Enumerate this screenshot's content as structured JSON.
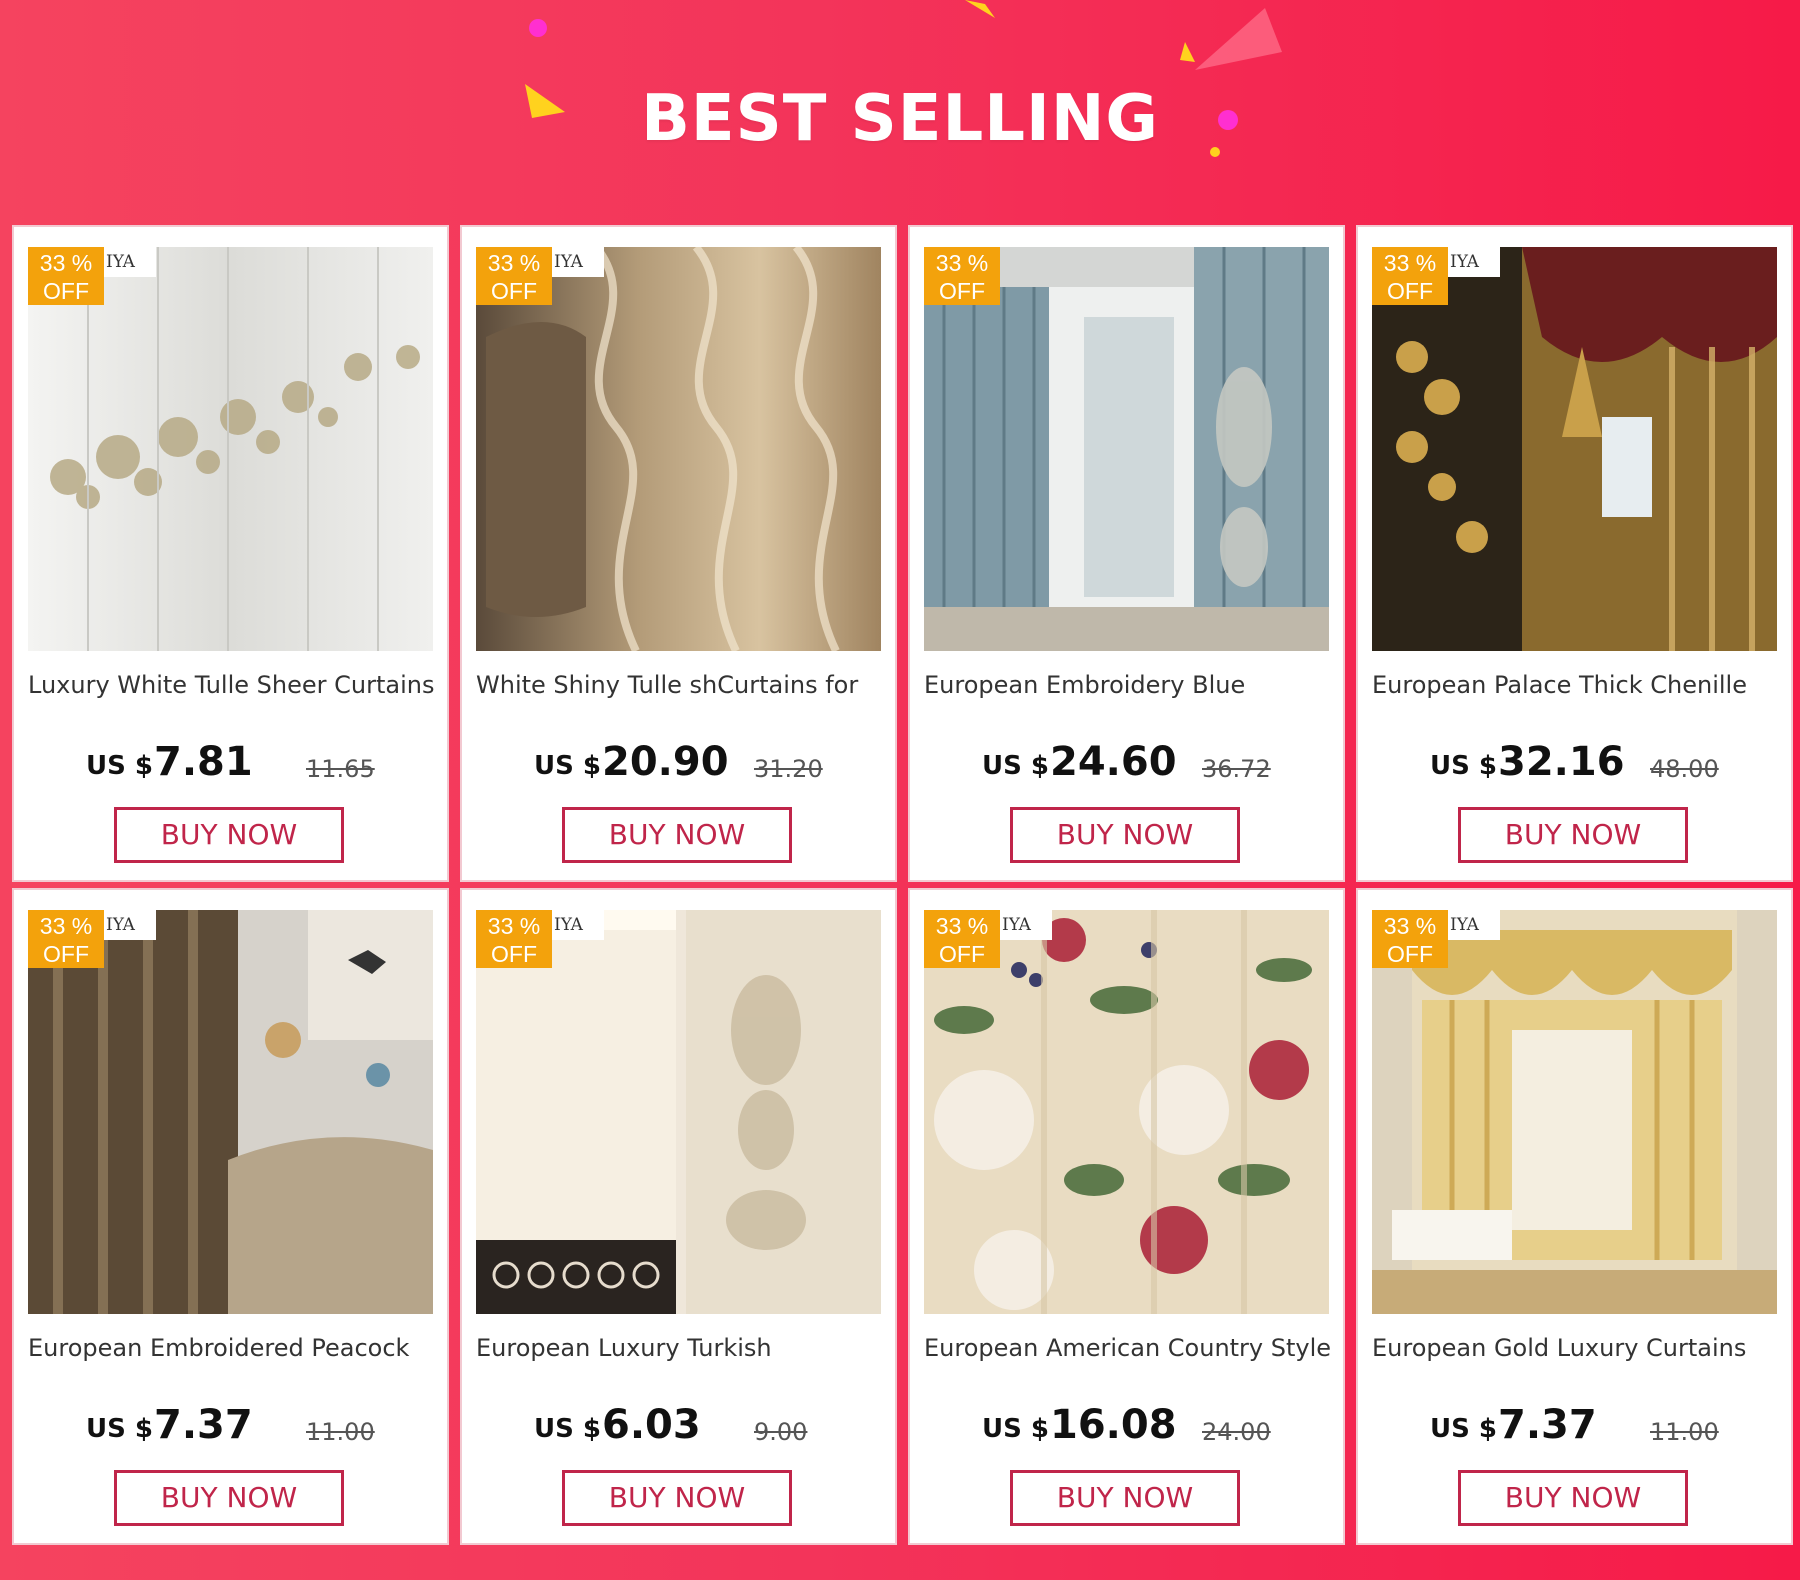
{
  "header": {
    "title": "BEST SELLING"
  },
  "colors": {
    "accent": "#f3345a",
    "button": "#c0254a",
    "badge": "#f3a20c"
  },
  "products": [
    {
      "badge_pct": "33 %",
      "badge_off": "OFF",
      "brand": "IYA",
      "name": "Luxury White Tulle Sheer Curtains",
      "currency": "US $",
      "price": "7.81",
      "old_price": "11.65",
      "button": "BUY NOW"
    },
    {
      "badge_pct": "33 %",
      "badge_off": "OFF",
      "brand": "IYA",
      "name": "White Shiny Tulle shCurtains for",
      "currency": "US $",
      "price": "20.90",
      "old_price": "31.20",
      "button": "BUY NOW"
    },
    {
      "badge_pct": "33 %",
      "badge_off": "OFF",
      "brand": "",
      "name": "European Embroidery Blue",
      "currency": "US $",
      "price": "24.60",
      "old_price": "36.72",
      "button": "BUY NOW"
    },
    {
      "badge_pct": "33 %",
      "badge_off": "OFF",
      "brand": "IYA",
      "name": "European Palace Thick Chenille",
      "currency": "US $",
      "price": "32.16",
      "old_price": "48.00",
      "button": "BUY NOW"
    },
    {
      "badge_pct": "33 %",
      "badge_off": "OFF",
      "brand": "IYA",
      "name": "European Embroidered Peacock",
      "currency": "US $",
      "price": "7.37",
      "old_price": "11.00",
      "button": "BUY NOW"
    },
    {
      "badge_pct": "33 %",
      "badge_off": "OFF",
      "brand": "IYA",
      "name": "European Luxury Turkish",
      "currency": "US $",
      "price": "6.03",
      "old_price": "9.00",
      "button": "BUY NOW"
    },
    {
      "badge_pct": "33 %",
      "badge_off": "OFF",
      "brand": "IYA",
      "name": "European American Country Style",
      "currency": "US $",
      "price": "16.08",
      "old_price": "24.00",
      "button": "BUY NOW"
    },
    {
      "badge_pct": "33 %",
      "badge_off": "OFF",
      "brand": "IYA",
      "name": "European Gold Luxury Curtains",
      "currency": "US $",
      "price": "7.37",
      "old_price": "11.00",
      "button": "BUY NOW"
    }
  ]
}
